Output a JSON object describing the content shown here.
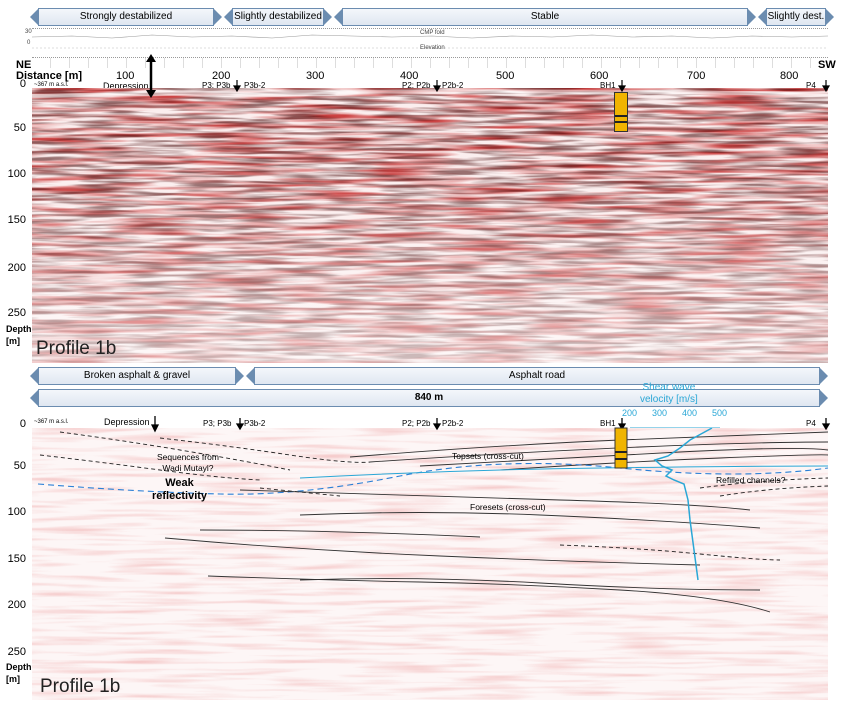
{
  "top_banners": [
    "Strongly destabilized",
    "Slightly destabilized",
    "Stable",
    "Slightly dest."
  ],
  "bottom_banners": [
    "Broken asphalt  & gravel",
    "Asphalt road"
  ],
  "length_label": "840 m",
  "mini_track_labels": [
    "CMP fold",
    "Elevation"
  ],
  "mini_axis": [
    "30",
    "0"
  ],
  "direction": {
    "left": "NE",
    "right": "SW"
  },
  "distance_label": "Distance [m]",
  "distance_ticks": [
    "100",
    "200",
    "300",
    "400",
    "500",
    "600",
    "700",
    "800"
  ],
  "depth_ticks": [
    "0",
    "50",
    "100",
    "150",
    "200",
    "250"
  ],
  "depth_title": "Depth\n[m]",
  "datum": "~367 m a.s.l.",
  "markers": {
    "depression": "Depression",
    "p3": "P3; P3b",
    "p3b2": "P3b-2",
    "p2": "P2; P2b",
    "p2b2": "P2b-2",
    "bh1": "BH1",
    "p4": "P4"
  },
  "profile_label": "Profile 1b",
  "velocity": {
    "title": "Shear wave\nvelocity [m/s]",
    "ticks": [
      "200",
      "300",
      "400",
      "500"
    ],
    "color": "#2aa7d6"
  },
  "annotations": {
    "sequences": "Sequences from\nWadi Mutayl?",
    "weak": "Weak\nreflectivity",
    "topsets": "Topsets (cross-cut)",
    "foresets": "Foresets (cross-cut)",
    "channels": "Refilled channels?"
  }
}
